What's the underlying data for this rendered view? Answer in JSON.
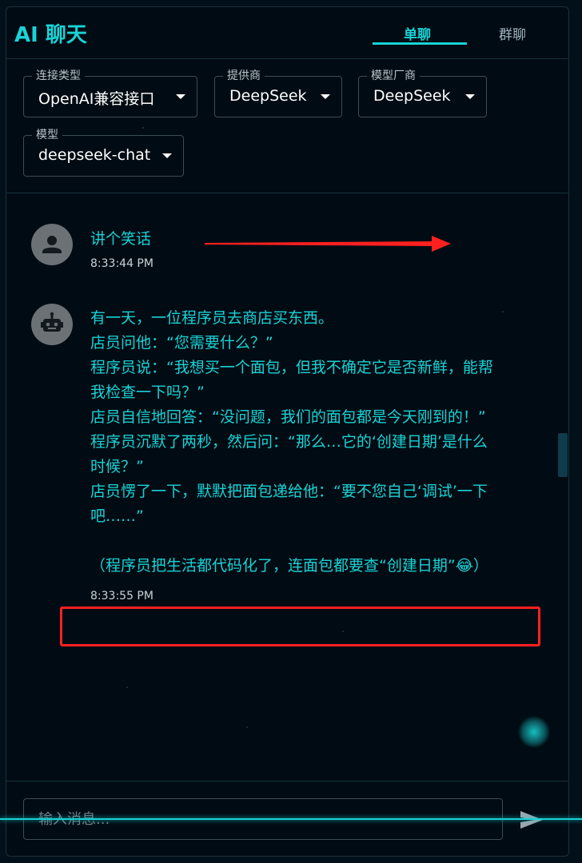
{
  "app": {
    "title": "AI 聊天"
  },
  "tabs": [
    {
      "label": "单聊",
      "active": true
    },
    {
      "label": "群聊",
      "active": false
    }
  ],
  "selectors": {
    "connection_type": {
      "label": "连接类型",
      "value": "OpenAI兼容接口"
    },
    "provider": {
      "label": "提供商",
      "value": "DeepSeek"
    },
    "model_vendor": {
      "label": "模型厂商",
      "value": "DeepSeek"
    },
    "model": {
      "label": "模型",
      "value": "deepseek-chat"
    }
  },
  "messages": [
    {
      "role": "user",
      "avatar_icon": "user-icon",
      "lines": [
        "讲个笑话"
      ],
      "time": "8:33:44 PM"
    },
    {
      "role": "assistant",
      "avatar_icon": "robot-icon",
      "lines": [
        "有一天，一位程序员去商店买东西。",
        "店员问他：“您需要什么？”",
        "程序员说：“我想买一个面包，但我不确定它是否新鲜，能帮",
        "我检查一下吗？”",
        "店员自信地回答：“没问题，我们的面包都是今天刚到的！”",
        "程序员沉默了两秒，然后问：“那么…它的‘创建日期’是什么",
        "时候？”",
        "店员愣了一下，默默把面包递给他：“要不您自己‘调试’一下",
        "吧……”",
        "",
        "（程序员把生活都代码化了，连面包都要查“创建日期”😂）"
      ],
      "time": "8:33:55 PM"
    }
  ],
  "input": {
    "placeholder": "输入消息...",
    "value": ""
  },
  "send_icon": "send-icon",
  "colors": {
    "accent": "#19d3d6",
    "annotation": "#ff2020",
    "background": "#010b13"
  }
}
